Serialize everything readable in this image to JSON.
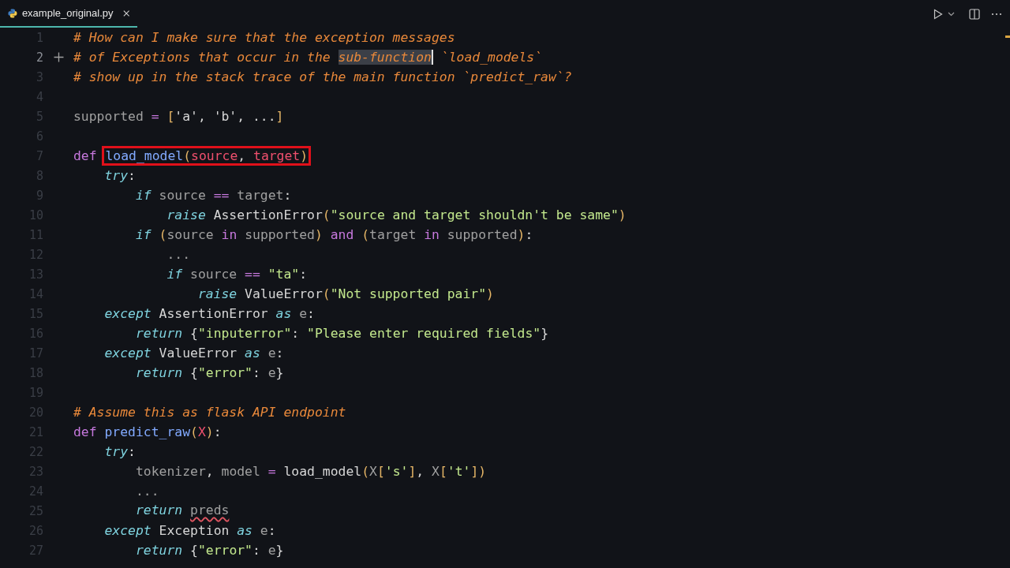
{
  "tab": {
    "filename": "example_original.py",
    "selected": true
  },
  "editor": {
    "lines": [
      {
        "number": "1",
        "active": false,
        "tokens": [
          {
            "kind": "comment",
            "text": "# How can I make sure that the exception messages"
          }
        ]
      },
      {
        "number": "2",
        "active": true,
        "tokens": [
          {
            "kind": "comment",
            "text": "# of Exceptions that occur in the "
          },
          {
            "kind": "comment",
            "text": "sub-function",
            "selected": true,
            "cursor": true
          },
          {
            "kind": "comment",
            "text": " `load_models`"
          }
        ]
      },
      {
        "number": "3",
        "active": false,
        "tokens": [
          {
            "kind": "comment",
            "text": "# show up in the stack trace of the main function `predict_raw`?"
          }
        ]
      },
      {
        "number": "4",
        "active": false
      },
      {
        "number": "5",
        "active": false,
        "tokens": [
          {
            "kind": "dim",
            "text": "supported"
          },
          {
            "kind": "op",
            "text": " = "
          },
          {
            "kind": "punct",
            "text": "["
          },
          {
            "kind": "plain",
            "text": "'a', 'b', ..."
          },
          {
            "kind": "punct",
            "text": "]"
          }
        ]
      },
      {
        "number": "6",
        "active": false
      },
      {
        "number": "7",
        "active": false,
        "tokens": [
          {
            "kind": "keyword",
            "text": "def "
          },
          {
            "kind": "func",
            "text": "load_model",
            "boxed": true
          },
          {
            "kind": "punct",
            "text": "(",
            "boxed": true
          },
          {
            "kind": "param",
            "text": "source",
            "boxed": true
          },
          {
            "kind": "plain",
            "text": ", ",
            "boxed": true
          },
          {
            "kind": "param",
            "text": "target",
            "boxed": true
          },
          {
            "kind": "punct",
            "text": ")",
            "boxed": true
          }
        ]
      },
      {
        "number": "8",
        "active": false,
        "tokens": [
          {
            "kind": "ctrl",
            "text": "    try"
          },
          {
            "kind": "plain",
            "text": ":"
          }
        ]
      },
      {
        "number": "9",
        "active": false,
        "tokens": [
          {
            "kind": "ctrl",
            "text": "        if "
          },
          {
            "kind": "dim",
            "text": "source"
          },
          {
            "kind": "op",
            "text": " == "
          },
          {
            "kind": "dim",
            "text": "target"
          },
          {
            "kind": "plain",
            "text": ":"
          }
        ]
      },
      {
        "number": "10",
        "active": false,
        "tokens": [
          {
            "kind": "ctrl",
            "text": "            raise"
          },
          {
            "kind": "plain",
            "text": " AssertionError"
          },
          {
            "kind": "punct",
            "text": "("
          },
          {
            "kind": "string",
            "text": "\"source and target shouldn't be same\""
          },
          {
            "kind": "punct",
            "text": ")"
          }
        ]
      },
      {
        "number": "11",
        "active": false,
        "tokens": [
          {
            "kind": "ctrl",
            "text": "        if "
          },
          {
            "kind": "punct",
            "text": "("
          },
          {
            "kind": "dim",
            "text": "source"
          },
          {
            "kind": "op",
            "text": " in "
          },
          {
            "kind": "dim",
            "text": "supported"
          },
          {
            "kind": "punct",
            "text": ")"
          },
          {
            "kind": "op",
            "text": " and "
          },
          {
            "kind": "punct",
            "text": "("
          },
          {
            "kind": "dim",
            "text": "target"
          },
          {
            "kind": "op",
            "text": " in "
          },
          {
            "kind": "dim",
            "text": "supported"
          },
          {
            "kind": "punct",
            "text": ")"
          },
          {
            "kind": "plain",
            "text": ":"
          }
        ]
      },
      {
        "number": "12",
        "active": false,
        "tokens": [
          {
            "kind": "dim",
            "text": "            ..."
          }
        ]
      },
      {
        "number": "13",
        "active": false,
        "tokens": [
          {
            "kind": "ctrl",
            "text": "            if"
          },
          {
            "kind": "dim",
            "text": " source"
          },
          {
            "kind": "op",
            "text": " == "
          },
          {
            "kind": "string",
            "text": "\"ta\""
          },
          {
            "kind": "plain",
            "text": ":"
          }
        ]
      },
      {
        "number": "14",
        "active": false,
        "tokens": [
          {
            "kind": "ctrl",
            "text": "                raise"
          },
          {
            "kind": "plain",
            "text": " ValueError"
          },
          {
            "kind": "punct",
            "text": "("
          },
          {
            "kind": "string",
            "text": "\"Not supported pair\""
          },
          {
            "kind": "punct",
            "text": ")"
          }
        ]
      },
      {
        "number": "15",
        "active": false,
        "tokens": [
          {
            "kind": "ctrl",
            "text": "    except"
          },
          {
            "kind": "plain",
            "text": " AssertionError "
          },
          {
            "kind": "ctrl",
            "text": "as"
          },
          {
            "kind": "dim",
            "text": " e"
          },
          {
            "kind": "plain",
            "text": ":"
          }
        ]
      },
      {
        "number": "16",
        "active": false,
        "tokens": [
          {
            "kind": "ctrl",
            "text": "        return"
          },
          {
            "kind": "plain",
            "text": " {"
          },
          {
            "kind": "string",
            "text": "\"inputerror\""
          },
          {
            "kind": "plain",
            "text": ": "
          },
          {
            "kind": "string",
            "text": "\"Please enter required fields\""
          },
          {
            "kind": "plain",
            "text": "}"
          }
        ]
      },
      {
        "number": "17",
        "active": false,
        "tokens": [
          {
            "kind": "ctrl",
            "text": "    except"
          },
          {
            "kind": "plain",
            "text": " ValueError "
          },
          {
            "kind": "ctrl",
            "text": "as"
          },
          {
            "kind": "dim",
            "text": " e"
          },
          {
            "kind": "plain",
            "text": ":"
          }
        ]
      },
      {
        "number": "18",
        "active": false,
        "tokens": [
          {
            "kind": "ctrl",
            "text": "        return"
          },
          {
            "kind": "plain",
            "text": " {"
          },
          {
            "kind": "string",
            "text": "\"error\""
          },
          {
            "kind": "plain",
            "text": ": "
          },
          {
            "kind": "dim",
            "text": "e"
          },
          {
            "kind": "plain",
            "text": "}"
          }
        ]
      },
      {
        "number": "19",
        "active": false
      },
      {
        "number": "20",
        "active": false,
        "tokens": [
          {
            "kind": "comment",
            "text": "# Assume this as flask API endpoint"
          }
        ]
      },
      {
        "number": "21",
        "active": false,
        "tokens": [
          {
            "kind": "keyword",
            "text": "def "
          },
          {
            "kind": "func",
            "text": "predict_raw"
          },
          {
            "kind": "punct",
            "text": "("
          },
          {
            "kind": "param",
            "text": "X"
          },
          {
            "kind": "punct",
            "text": ")"
          },
          {
            "kind": "plain",
            "text": ":"
          }
        ]
      },
      {
        "number": "22",
        "active": false,
        "tokens": [
          {
            "kind": "ctrl",
            "text": "    try"
          },
          {
            "kind": "plain",
            "text": ":"
          }
        ]
      },
      {
        "number": "23",
        "active": false,
        "tokens": [
          {
            "kind": "dim",
            "text": "        tokenizer"
          },
          {
            "kind": "plain",
            "text": ", "
          },
          {
            "kind": "dim",
            "text": "model"
          },
          {
            "kind": "op",
            "text": " = "
          },
          {
            "kind": "plain",
            "text": "load_model"
          },
          {
            "kind": "punct",
            "text": "("
          },
          {
            "kind": "dim",
            "text": "X"
          },
          {
            "kind": "punct",
            "text": "["
          },
          {
            "kind": "string",
            "text": "'s'"
          },
          {
            "kind": "punct",
            "text": "]"
          },
          {
            "kind": "plain",
            "text": ", "
          },
          {
            "kind": "dim",
            "text": "X"
          },
          {
            "kind": "punct",
            "text": "["
          },
          {
            "kind": "string",
            "text": "'t'"
          },
          {
            "kind": "punct",
            "text": "])"
          }
        ]
      },
      {
        "number": "24",
        "active": false,
        "tokens": [
          {
            "kind": "dim",
            "text": "        ..."
          }
        ]
      },
      {
        "number": "25",
        "active": false,
        "tokens": [
          {
            "kind": "ctrl",
            "text": "        return "
          },
          {
            "kind": "dim",
            "text": "preds",
            "error": true
          }
        ]
      },
      {
        "number": "26",
        "active": false,
        "tokens": [
          {
            "kind": "ctrl",
            "text": "    except"
          },
          {
            "kind": "plain",
            "text": " Exception "
          },
          {
            "kind": "ctrl",
            "text": "as"
          },
          {
            "kind": "dim",
            "text": " e"
          },
          {
            "kind": "plain",
            "text": ":"
          }
        ]
      },
      {
        "number": "27",
        "active": false,
        "tokens": [
          {
            "kind": "ctrl",
            "text": "        return"
          },
          {
            "kind": "plain",
            "text": " {"
          },
          {
            "kind": "string",
            "text": "\"error\""
          },
          {
            "kind": "plain",
            "text": ": "
          },
          {
            "kind": "dim",
            "text": "e"
          },
          {
            "kind": "plain",
            "text": "}"
          }
        ]
      }
    ]
  }
}
